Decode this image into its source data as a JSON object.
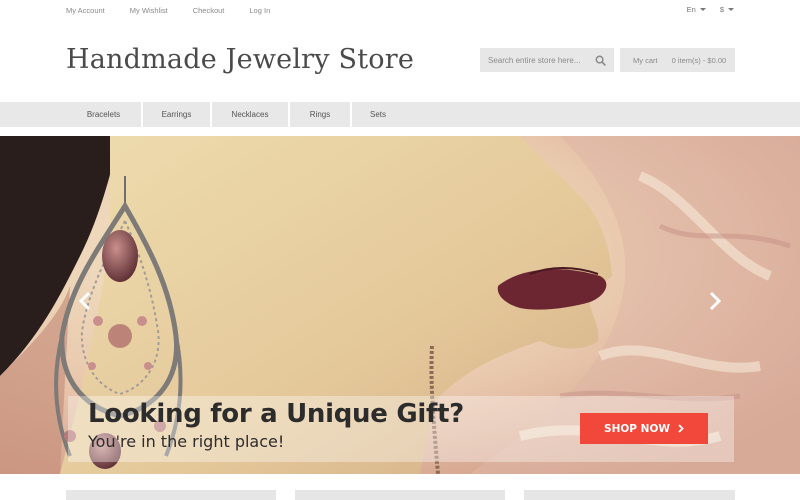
{
  "topbar": {
    "links": [
      {
        "label": "My Account"
      },
      {
        "label": "My Wishlist"
      },
      {
        "label": "Checkout"
      },
      {
        "label": "Log In"
      }
    ],
    "language": "En",
    "currency": "$"
  },
  "header": {
    "logo": "Handmade Jewelry Store",
    "search_placeholder": "Search entire store here...",
    "cart_label": "My cart",
    "cart_summary": "0 item(s) - $0.00"
  },
  "nav": {
    "items": [
      {
        "label": "Bracelets"
      },
      {
        "label": "Earrings"
      },
      {
        "label": "Necklaces"
      },
      {
        "label": "Rings"
      },
      {
        "label": "Sets"
      }
    ]
  },
  "hero": {
    "title": "Looking for a Unique Gift?",
    "subtitle": "You're in the right place!",
    "button_label": "SHOP NOW",
    "prev_icon": "chevron-left-icon",
    "next_icon": "chevron-right-icon"
  },
  "colors": {
    "accent": "#f2483b",
    "nav_bg": "#e8e8e8",
    "control_bg": "#e7e7e7",
    "text_dark": "#2c2c2c"
  }
}
